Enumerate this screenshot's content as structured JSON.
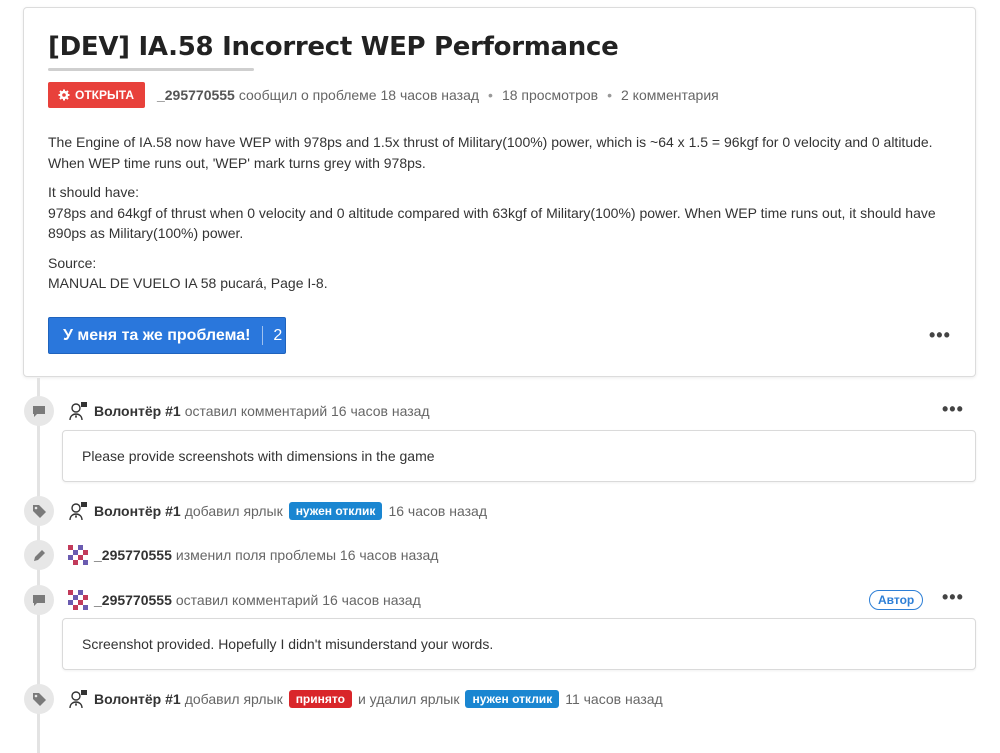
{
  "issue": {
    "title": "[DEV] IA.58 Incorrect WEP Performance",
    "status_label": "ОТКРЫТА",
    "author": "_295770555",
    "reported_text": "сообщил о проблеме 18 часов назад",
    "views": "18 просмотров",
    "comments": "2 комментария",
    "description": {
      "p1": "The Engine of IA.58 now have WEP with 978ps and 1.5x thrust of Military(100%) power, which is ~64 x 1.5 = 96kgf for 0 velocity and 0 altitude. When WEP time runs out, 'WEP' mark turns grey with 978ps.",
      "p2_heading": "It should have:",
      "p2_body": "978ps and 64kgf of thrust when 0 velocity and 0 altitude compared with 63kgf of Military(100%) power. When WEP time runs out, it should have 890ps as Military(100%) power.",
      "p3_heading": "Source:",
      "p3_body": "MANUAL DE VUELO IA 58 pucará, Page I-8."
    },
    "same_problem_label": "У меня та же проблема!",
    "same_problem_count": "2",
    "more_label": "•••"
  },
  "timeline": {
    "e1": {
      "user": "Волонтёр #1",
      "action": "оставил комментарий 16 часов назад",
      "more_label": "•••",
      "icon": "comment-icon"
    },
    "c1": {
      "text": "Please provide screenshots with dimensions in the game"
    },
    "e2": {
      "user": "Волонтёр #1",
      "action": "добавил ярлык",
      "tag": "нужен отклик",
      "time": "16 часов назад",
      "icon": "tag-icon"
    },
    "e3": {
      "user": "_295770555",
      "action": "изменил поля проблемы 16 часов назад",
      "icon": "pencil-icon"
    },
    "e4": {
      "user": "_295770555",
      "action": "оставил комментарий 16 часов назад",
      "author_badge": "Автор",
      "more_label": "•••",
      "icon": "comment-icon"
    },
    "c2": {
      "text": "Screenshot provided. Hopefully I didn't misunderstand your words."
    },
    "e5": {
      "user": "Волонтёр #1",
      "action": "добавил ярлык",
      "tag_added": "принято",
      "middle": "и удалил ярлык",
      "tag_removed": "нужен отклик",
      "time": "11 часов назад",
      "icon": "tag-icon"
    }
  },
  "colors": {
    "status": "#e8413b",
    "primary": "#2a77dc",
    "tag_blue": "#1a86d1",
    "tag_red": "#d9262a"
  }
}
